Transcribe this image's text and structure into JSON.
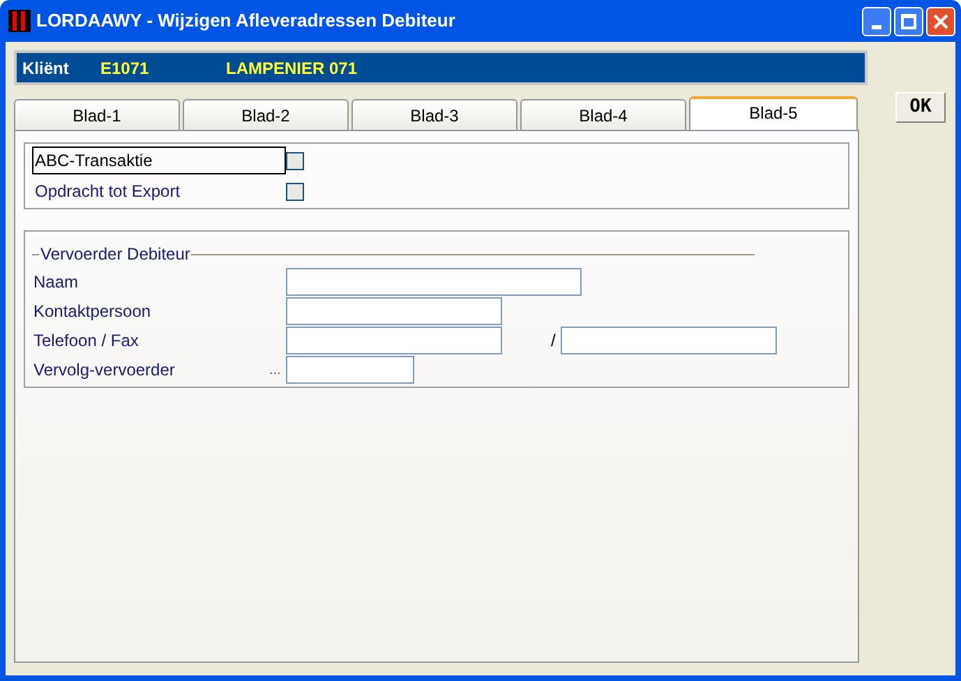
{
  "window": {
    "title": "LORDAAWY - Wijzigen Afleveradressen Debiteur"
  },
  "client": {
    "label": "Kliënt",
    "code": "E1071",
    "name": "LAMPENIER 071"
  },
  "tabs": [
    {
      "label": "Blad-1",
      "selected": false
    },
    {
      "label": "Blad-2",
      "selected": false
    },
    {
      "label": "Blad-3",
      "selected": false
    },
    {
      "label": "Blad-4",
      "selected": false
    },
    {
      "label": "Blad-5",
      "selected": true
    }
  ],
  "ok_button": "OK",
  "options": [
    {
      "label": "ABC-Transaktie",
      "checked": false,
      "focused": true
    },
    {
      "label": "Opdracht tot Export",
      "checked": false,
      "focused": false
    }
  ],
  "carrier_group": {
    "legend": "Vervoerder Debiteur",
    "fields": [
      {
        "kind": "single",
        "label": "Naam"
      },
      {
        "kind": "single",
        "label": "Kontaktpersoon"
      },
      {
        "kind": "pair",
        "label": "Telefoon / Fax",
        "separator": "/"
      },
      {
        "kind": "lookup",
        "label": "Vervolg-vervoerder",
        "prefix": "..."
      }
    ]
  }
}
